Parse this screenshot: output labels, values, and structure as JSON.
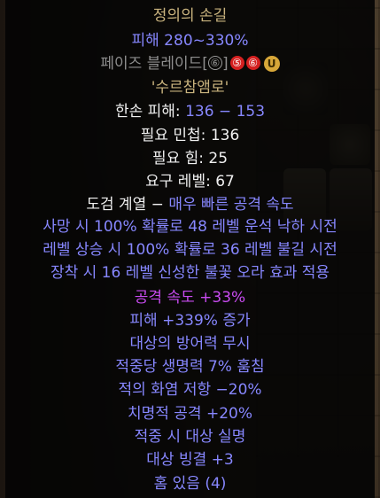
{
  "item": {
    "name": "정의의 손길",
    "damage": "피해 280~330%",
    "base_type": "페이즈 블레이드",
    "bracket_open": "[",
    "sockets_gray": "⑥",
    "bracket_close": "]",
    "requirement_red_1": "⑤",
    "requirement_red_2": "⑥",
    "unique_badge": "U",
    "rune_word": "'수르참앰로'",
    "one_hand_damage": {
      "label": "한손 피해: ",
      "value": "136 − 153"
    },
    "req_dex": "필요 민첩: 136",
    "req_str": "필요 힘: 25",
    "req_level": "요구 레벨: 67",
    "weapon_class": {
      "label": "도검 계열 − ",
      "value": "매우 빠른 공격 속도"
    },
    "mods_blue_1": [
      "사망 시 100% 확률로 48 레벨 운석 낙하 시전",
      "레벨 상승 시 100% 확률로 36 레벨 불길 시전",
      "장착 시 16 레벨 신성한 불꽃 오라 효과 적용"
    ],
    "mod_purple": "공격 속도 +33%",
    "mods_blue_2": [
      "피해 +339% 증가",
      "대상의 방어력 무시",
      "적중당 생명력 7% 훔침",
      "적의 화염 저항 −20%",
      "치명적 공격 +20%",
      "적중 시 대상 실명",
      "대상 빙결 +3",
      "홈 있음 (4)"
    ]
  },
  "colors": {
    "unique_gold": "#c9b37e",
    "magic_blue": "#8787ff",
    "base_gray": "#8e8e8e",
    "white": "#f0f0f0",
    "purple": "#c84bf0",
    "socket_red": "#d42020",
    "badge_gold": "#d7a739"
  },
  "icons": {
    "unique_badge": "unique-rune-badge-icon",
    "socket": "socket-count-icon"
  }
}
